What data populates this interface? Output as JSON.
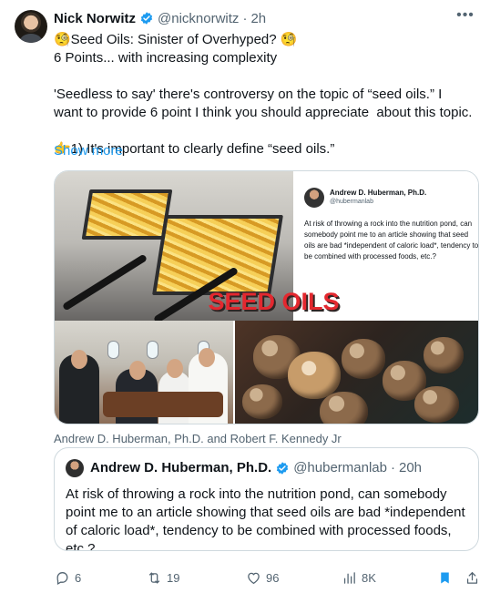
{
  "author": {
    "name": "Nick Norwitz",
    "handle": "@nicknorwitz",
    "separator": "·",
    "time": "2h"
  },
  "post": {
    "text": "🧐Seed Oils: Sinister of Overhyped? 🧐\n6 Points... with increasing complexity\n\n'Seedless to say' there's controversy on the topic of “seed oils.” I want to provide 6 point I think you should appreciate  about this topic.\n\n👉1) It's important to clearly define “seed oils.”",
    "show_more": "Show more"
  },
  "media": {
    "label": "SEED OILS",
    "tweet_card": {
      "name": "Andrew D. Huberman, Ph.D.",
      "handle": "@hubermanlab",
      "text": "At risk of throwing a rock into the nutrition pond, can somebody point me to an article showing that seed oils are bad *independent of caloric load*, tendency to be combined with processed foods, etc.?"
    }
  },
  "caption": "Andrew D. Huberman, Ph.D. and Robert F. Kennedy Jr",
  "quote": {
    "name": "Andrew D. Huberman, Ph.D.",
    "handle": "@hubermanlab",
    "separator": "·",
    "time": "20h",
    "text": "At risk of throwing a rock into the nutrition pond, can somebody point me to an article showing that seed oils are bad *independent of caloric load*, tendency to be combined with processed foods, etc.?\nTo be clear: I don't eat seed oils because I don't like the taste. Olive oil,"
  },
  "actions": {
    "replies": "6",
    "reposts": "19",
    "likes": "96",
    "views": "8K"
  },
  "colors": {
    "accent": "#1d9bf0",
    "text": "#0f1419",
    "secondary": "#536471",
    "border": "#cfd9de",
    "seed_label": "#e3282f"
  },
  "icons": {
    "verified": "verified-badge-icon",
    "more": "more-icon",
    "reply": "reply-icon",
    "repost": "repost-icon",
    "like": "like-icon",
    "views": "views-icon",
    "bookmark": "bookmark-icon",
    "share": "share-icon"
  }
}
